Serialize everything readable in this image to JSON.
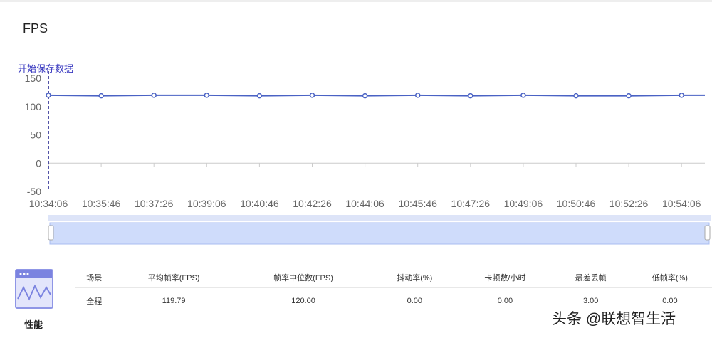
{
  "title": "FPS",
  "chart_data": {
    "type": "line",
    "title": "FPS",
    "annotation": "开始保存数据",
    "x": [
      "10:34:06",
      "10:35:46",
      "10:37:26",
      "10:39:06",
      "10:40:46",
      "10:42:26",
      "10:44:06",
      "10:45:46",
      "10:47:26",
      "10:49:06",
      "10:50:46",
      "10:52:26",
      "10:54:06"
    ],
    "series": [
      {
        "name": "FPS",
        "values": [
          120,
          119,
          120,
          120,
          119,
          120,
          119,
          120,
          119,
          120,
          119,
          119,
          120
        ]
      }
    ],
    "ylim": [
      -50,
      150
    ],
    "yticks": [
      "150",
      "100",
      "50",
      "0",
      "-50"
    ],
    "color": "#4a62c4"
  },
  "sidebar": {
    "label": "性能"
  },
  "table": {
    "headers": [
      "场景",
      "平均帧率(FPS)",
      "帧率中位数(FPS)",
      "抖动率(%)",
      "卡顿数/小时",
      "最差丢帧",
      "低帧率(%)"
    ],
    "rows": [
      [
        "全程",
        "119.79",
        "120.00",
        "0.00",
        "0.00",
        "3.00",
        "0.00"
      ]
    ]
  },
  "watermark": "头条 @联想智生活"
}
